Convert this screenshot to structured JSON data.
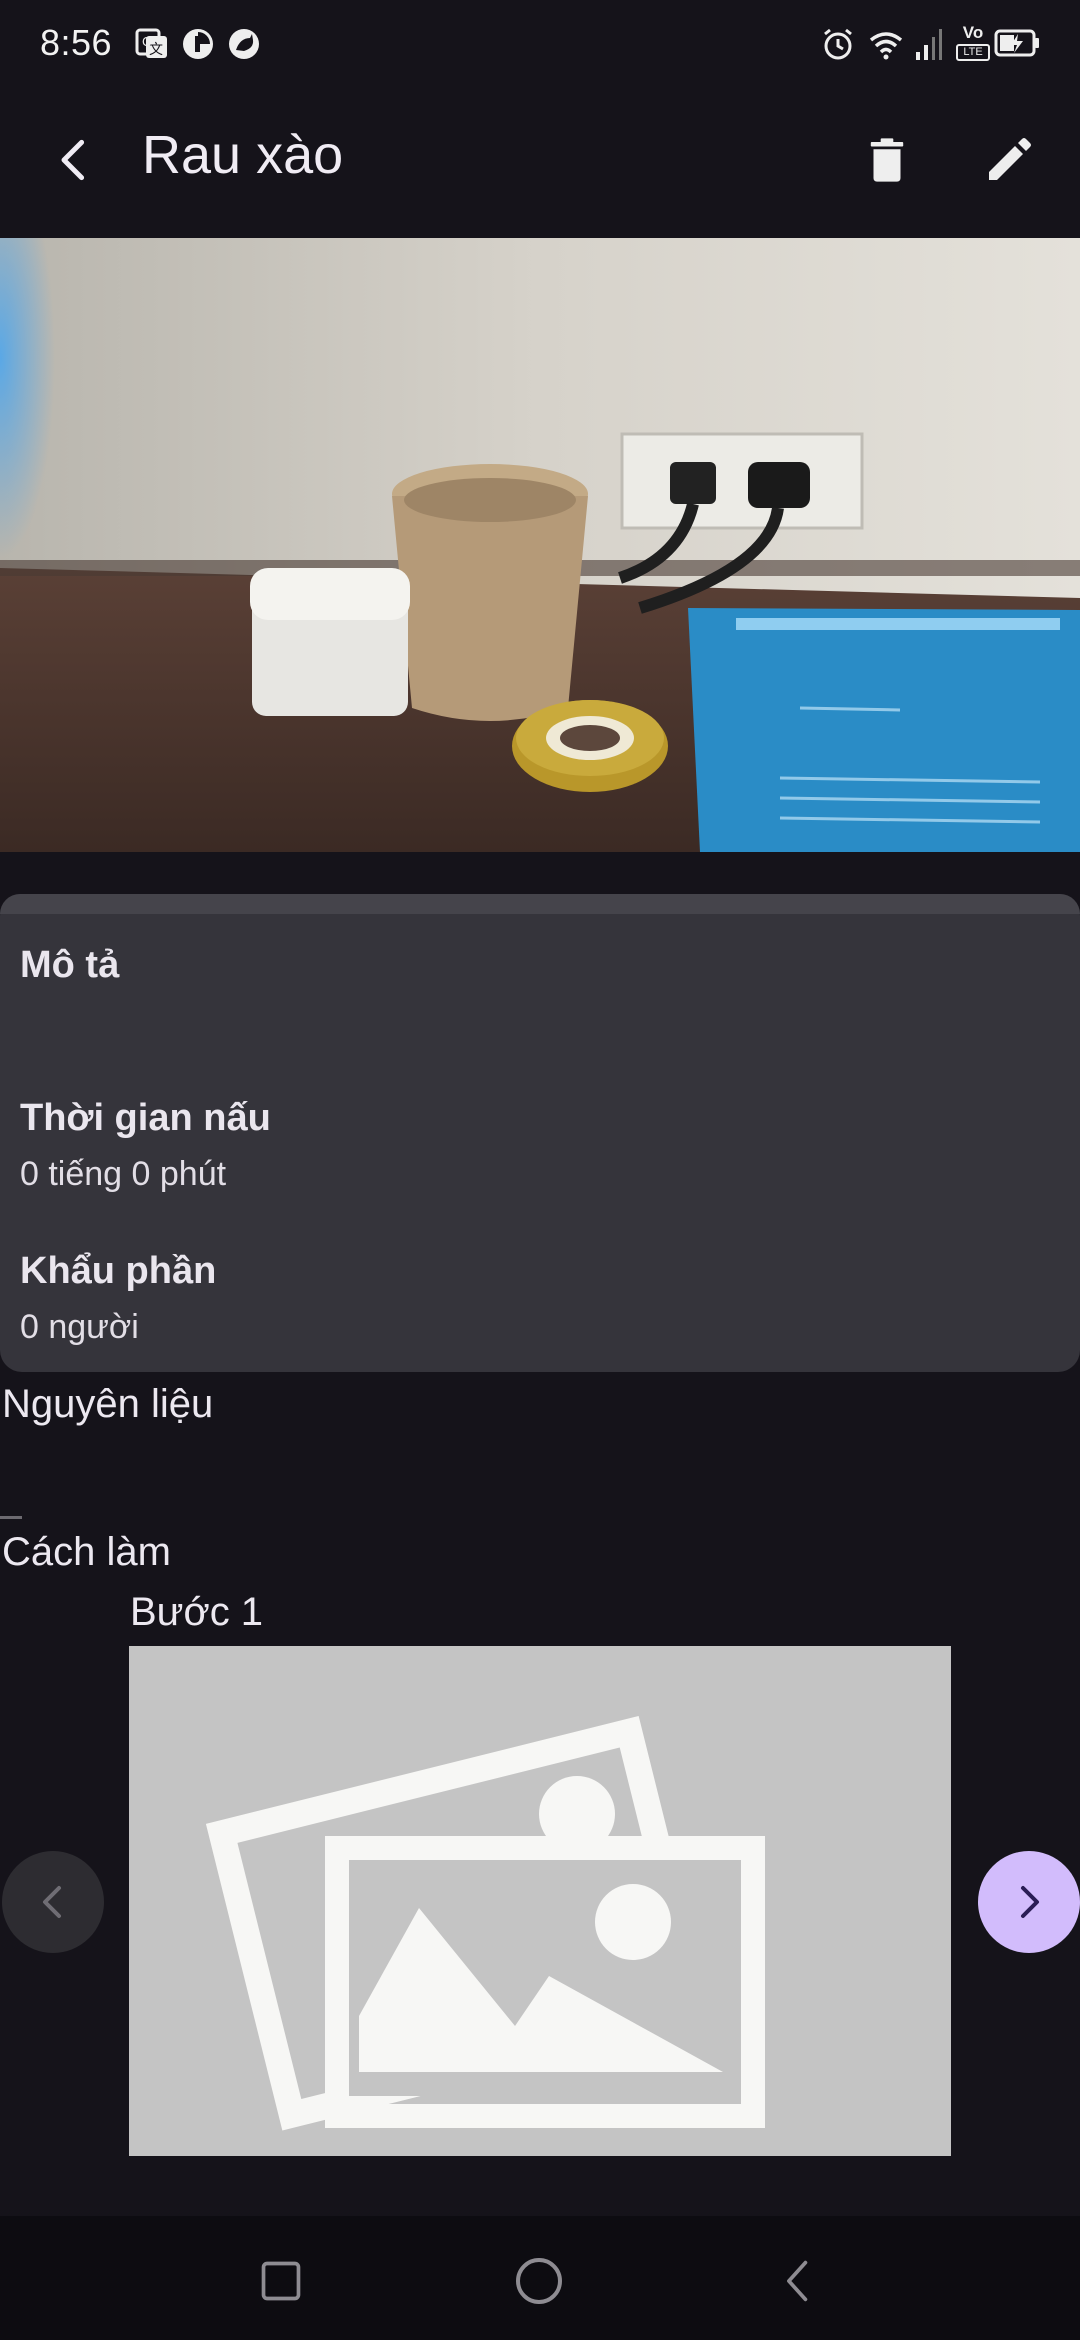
{
  "status_bar": {
    "time": "8:56",
    "left_icons": [
      "translate-icon",
      "pie-icon",
      "cat-icon"
    ],
    "right_icons": [
      "alarm-icon",
      "wifi-icon",
      "signal-icon",
      "volte-icon",
      "battery-charging-icon"
    ],
    "volte_top": "Vo",
    "volte_bottom": "LTE"
  },
  "app_bar": {
    "title": "Rau xào",
    "actions": [
      "delete-icon",
      "edit-icon"
    ]
  },
  "details": {
    "description_label": "Mô tả",
    "description_value": "",
    "cook_time_label": "Thời gian nấu",
    "cook_time_value": "0 tiếng 0 phút",
    "servings_label": "Khẩu phần",
    "servings_value": "0 người"
  },
  "ingredients": {
    "heading": "Nguyên liệu"
  },
  "steps": {
    "heading": "Cách làm",
    "current_step": "Bước 1"
  },
  "colors": {
    "background": "#15131a",
    "card": "#35343b",
    "accent": "#d2bcfc",
    "placeholder": "#c4c4c4"
  }
}
